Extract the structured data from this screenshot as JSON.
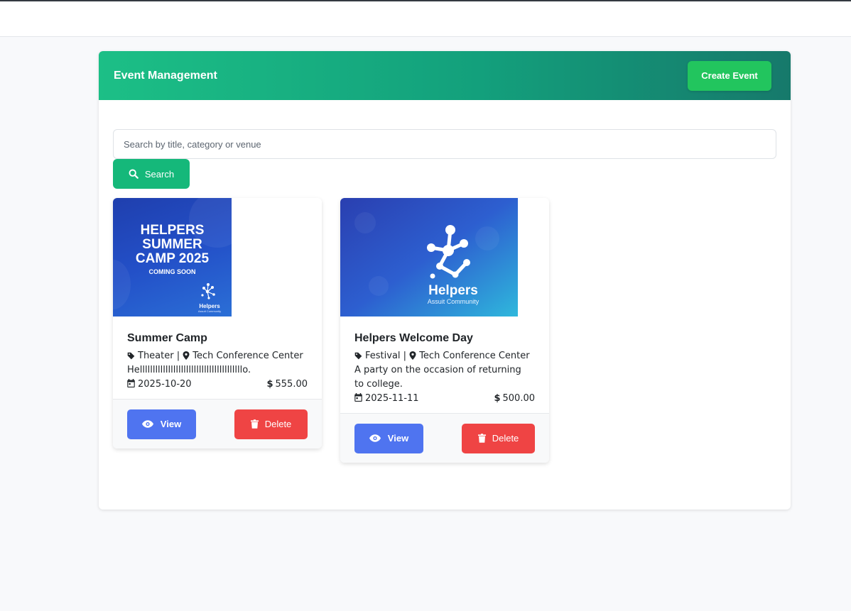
{
  "header": {
    "title": "Event Management",
    "create_label": "Create Event"
  },
  "search": {
    "placeholder": "Search by title, category or venue",
    "button_label": "Search"
  },
  "colors": {
    "header_start": "#1cbf86",
    "header_end": "#16796b",
    "create": "#22c55e",
    "search": "#15b87a",
    "view": "#4f74f0",
    "delete": "#ef4444"
  },
  "events": [
    {
      "title": "Summer Camp",
      "category": "Theater",
      "venue": "Tech Conference Center",
      "description": "Hellllllllllllllllllllllllllllllllllllllllo.",
      "date": "2025-10-20",
      "price": "555.00",
      "view_label": "View",
      "delete_label": "Delete",
      "poster": {
        "line1": "HELPERS",
        "line2": "SUMMER",
        "line3": "CAMP 2025",
        "tagline": "COMING SOON",
        "brand": "Helpers",
        "brand_sub": "Assuit Community"
      }
    },
    {
      "title": "Helpers Welcome Day",
      "category": "Festival",
      "venue": "Tech Conference Center",
      "description": "A party on the occasion of returning to college.",
      "date": "2025-11-11",
      "price": "500.00",
      "view_label": "View",
      "delete_label": "Delete",
      "poster": {
        "brand": "Helpers",
        "brand_sub": "Assuit Community"
      }
    }
  ],
  "icons": [
    "search-icon",
    "tag-icon",
    "map-pin-icon",
    "calendar-icon",
    "dollar-icon",
    "eye-icon",
    "trash-icon"
  ]
}
